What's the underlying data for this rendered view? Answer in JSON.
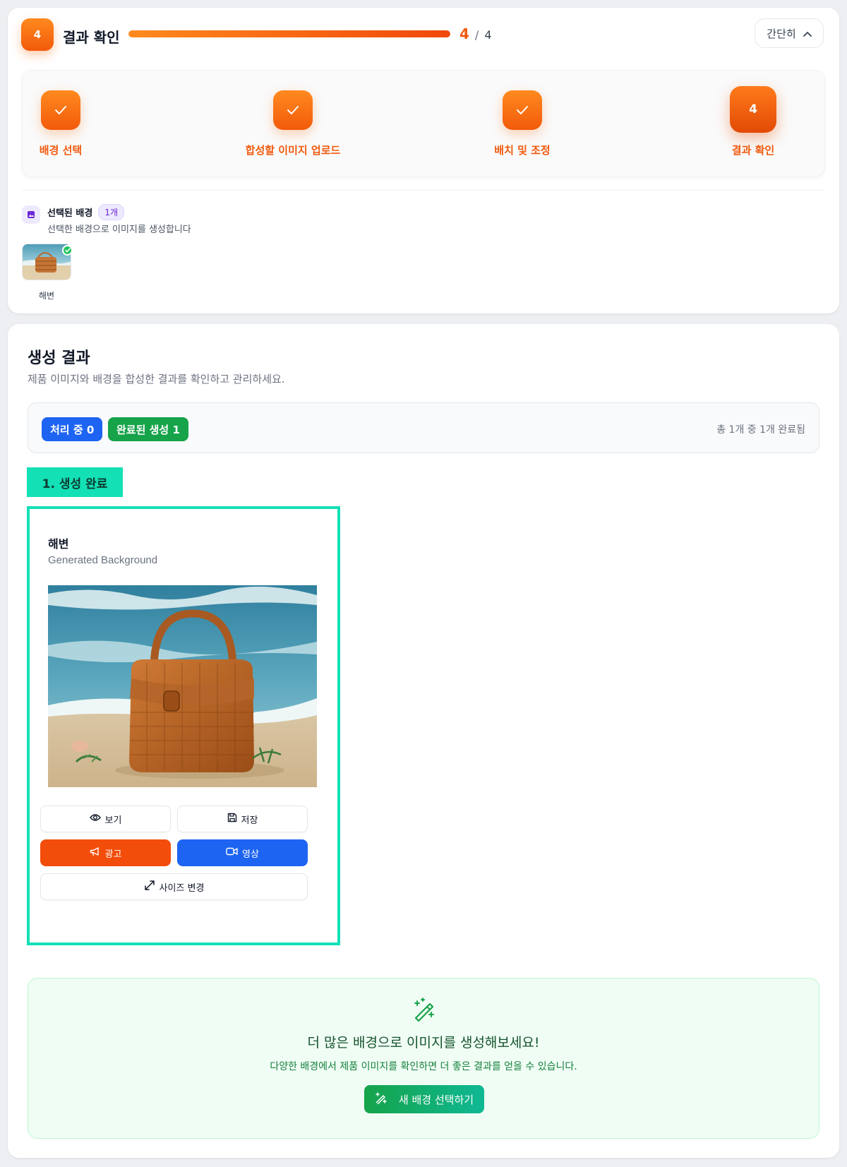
{
  "header": {
    "step_number": "4",
    "step_title": "결과 확인",
    "progress_fraction": 1.0,
    "progress_current": "4",
    "progress_separator": "/",
    "progress_total": "4",
    "collapse_label": "간단히"
  },
  "stepper": {
    "steps": [
      {
        "label": "배경 선택",
        "state": "done"
      },
      {
        "label": "합성할 이미지 업로드",
        "state": "done"
      },
      {
        "label": "배치 및 조정",
        "state": "done"
      },
      {
        "label": "결과 확인",
        "state": "current",
        "number": "4"
      }
    ]
  },
  "selected_background": {
    "title": "선택된 배경",
    "count": "1개",
    "subtitle": "선택한 배경으로 이미지를 생성합니다",
    "thumbnail_label": "해변"
  },
  "results": {
    "title": "생성 결과",
    "subtitle": "제품 이미지와 배경을 합성한 결과를 확인하고 관리하세요.",
    "processing_badge": "처리 중 0",
    "completed_badge": "완료된 생성 1",
    "summary": "총 1개 중 1개 완료됨",
    "item_label": "1. 생성 완료",
    "item": {
      "title": "해변",
      "subtitle": "Generated Background",
      "buttons": {
        "view": "보기",
        "save": "저장",
        "ad": "광고",
        "video": "영상",
        "resize": "사이즈 변경"
      }
    }
  },
  "cta": {
    "title": "더 많은 배경으로 이미지를 생성해보세요!",
    "subtitle": "다양한 배경에서 제품 이미지를 확인하면 더 좋은 결과를 얻을 수 있습니다.",
    "button": "새 배경 선택하기"
  },
  "colors": {
    "accent_orange": "#f05a0e",
    "teal_highlight": "#13e0b5",
    "blue": "#1d64f2",
    "green": "#16a34a"
  }
}
